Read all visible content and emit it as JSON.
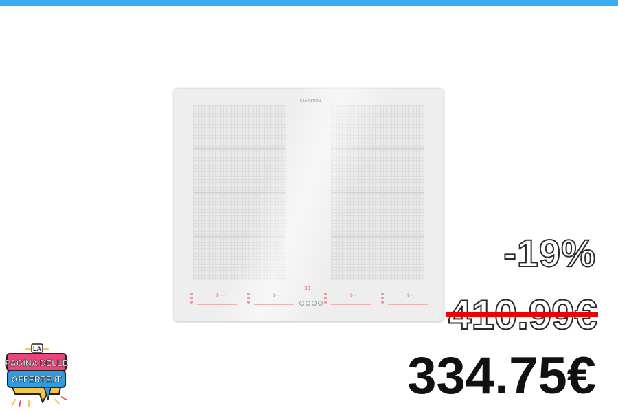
{
  "product": {
    "image_name": "induction-cooktop",
    "brand_label": "KLARSTEIN",
    "timer_display": "30"
  },
  "price": {
    "discount": "-19%",
    "old_price": "410.99€",
    "new_price": "334.75€"
  },
  "logo": {
    "line1": "LA",
    "line2": "PAGINA DELLE",
    "line3": "OFFERTE.IT"
  },
  "colors": {
    "top_bar": "#39aef0",
    "strike": "#ee0000",
    "logo_pink": "#e8467c",
    "logo_blue": "#2f9be0",
    "logo_yellow": "#f6c64b"
  }
}
